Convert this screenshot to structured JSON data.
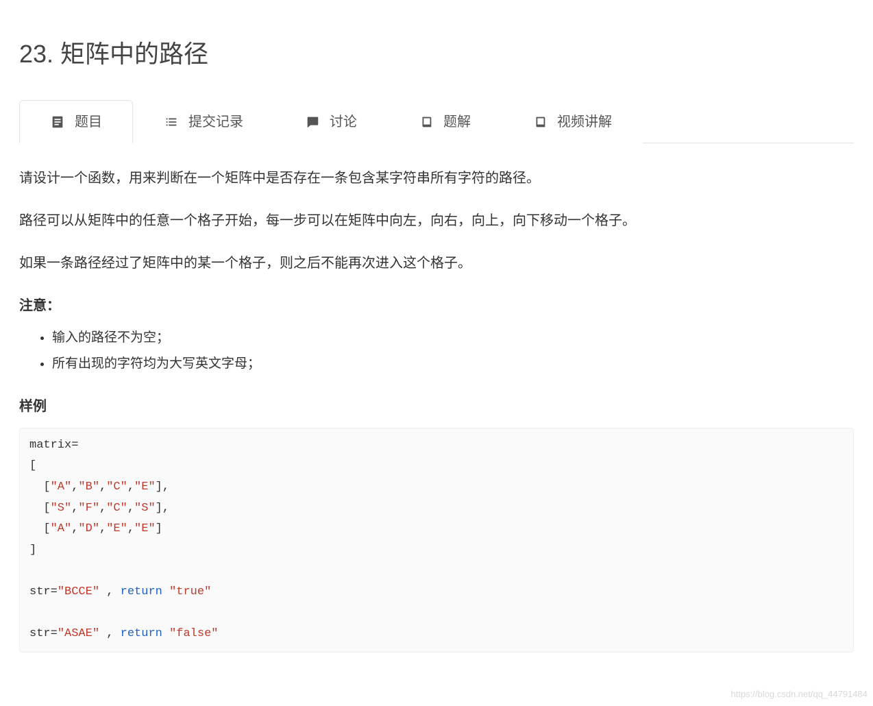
{
  "title": "23. 矩阵中的路径",
  "tabs": [
    {
      "icon": "doc",
      "label": "题目",
      "active": true
    },
    {
      "icon": "list",
      "label": "提交记录",
      "active": false
    },
    {
      "icon": "comment",
      "label": "讨论",
      "active": false
    },
    {
      "icon": "book",
      "label": "题解",
      "active": false
    },
    {
      "icon": "book",
      "label": "视频讲解",
      "active": false
    }
  ],
  "paragraphs": [
    "请设计一个函数，用来判断在一个矩阵中是否存在一条包含某字符串所有字符的路径。",
    "路径可以从矩阵中的任意一个格子开始，每一步可以在矩阵中向左，向右，向上，向下移动一个格子。",
    "如果一条路径经过了矩阵中的某一个格子，则之后不能再次进入这个格子。"
  ],
  "note_heading": "注意：",
  "notes": [
    "输入的路径不为空；",
    "所有出现的字符均为大写英文字母；"
  ],
  "sample_heading": "样例",
  "code": {
    "tokens": [
      {
        "t": "plain",
        "v": "matrix=\n[\n  ["
      },
      {
        "t": "str",
        "v": "\"A\""
      },
      {
        "t": "plain",
        "v": ","
      },
      {
        "t": "str",
        "v": "\"B\""
      },
      {
        "t": "plain",
        "v": ","
      },
      {
        "t": "str",
        "v": "\"C\""
      },
      {
        "t": "plain",
        "v": ","
      },
      {
        "t": "str",
        "v": "\"E\""
      },
      {
        "t": "plain",
        "v": "],\n  ["
      },
      {
        "t": "str",
        "v": "\"S\""
      },
      {
        "t": "plain",
        "v": ","
      },
      {
        "t": "str",
        "v": "\"F\""
      },
      {
        "t": "plain",
        "v": ","
      },
      {
        "t": "str",
        "v": "\"C\""
      },
      {
        "t": "plain",
        "v": ","
      },
      {
        "t": "str",
        "v": "\"S\""
      },
      {
        "t": "plain",
        "v": "],\n  ["
      },
      {
        "t": "str",
        "v": "\"A\""
      },
      {
        "t": "plain",
        "v": ","
      },
      {
        "t": "str",
        "v": "\"D\""
      },
      {
        "t": "plain",
        "v": ","
      },
      {
        "t": "str",
        "v": "\"E\""
      },
      {
        "t": "plain",
        "v": ","
      },
      {
        "t": "str",
        "v": "\"E\""
      },
      {
        "t": "plain",
        "v": "]\n]\n\nstr="
      },
      {
        "t": "str",
        "v": "\"BCCE\""
      },
      {
        "t": "plain",
        "v": " , "
      },
      {
        "t": "kw",
        "v": "return"
      },
      {
        "t": "plain",
        "v": " "
      },
      {
        "t": "str",
        "v": "\"true\""
      },
      {
        "t": "plain",
        "v": "\n\nstr="
      },
      {
        "t": "str",
        "v": "\"ASAE\""
      },
      {
        "t": "plain",
        "v": " , "
      },
      {
        "t": "kw",
        "v": "return"
      },
      {
        "t": "plain",
        "v": " "
      },
      {
        "t": "str",
        "v": "\"false\""
      }
    ]
  },
  "watermark": "https://blog.csdn.net/qq_44791484"
}
